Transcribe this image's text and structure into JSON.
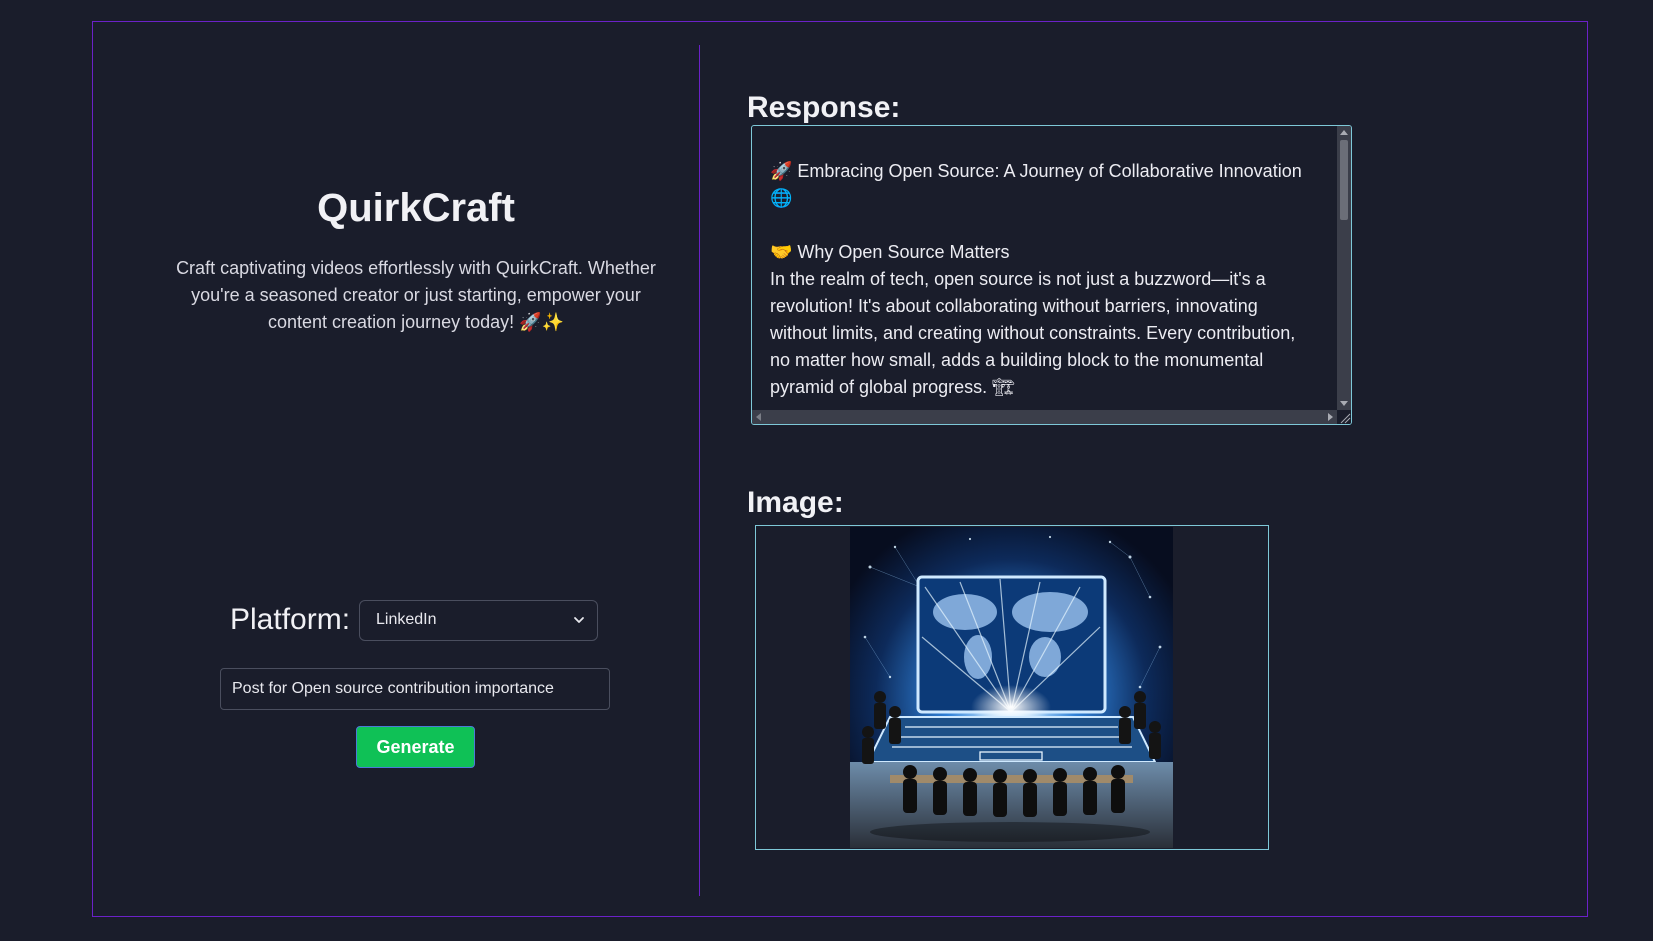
{
  "app": {
    "title": "QuirkCraft",
    "description": "Craft captivating videos effortlessly with QuirkCraft. Whether you're a seasoned creator or just starting, empower your content creation journey today! 🚀✨"
  },
  "form": {
    "platform_label": "Platform:",
    "platform_selected": "LinkedIn",
    "prompt_value": "Post for Open source contribution importance",
    "generate_label": "Generate"
  },
  "output": {
    "response_label": "Response:",
    "response_text": "🚀 Embracing Open Source: A Journey of Collaborative Innovation 🌐\n\n🤝 Why Open Source Matters\nIn the realm of tech, open source is not just a buzzword—it's a revolution! It's about collaborating without barriers, innovating without limits, and creating without constraints. Every contribution, no matter how small, adds a building block to the monumental pyramid of global progress. 🏗",
    "image_label": "Image:"
  },
  "colors": {
    "background": "#1a1d2b",
    "frame_border": "#6b21c8",
    "output_border": "#7ec8d8",
    "generate_button": "#0fc156"
  },
  "icons": {
    "select_arrow": "chevron-down-icon"
  }
}
